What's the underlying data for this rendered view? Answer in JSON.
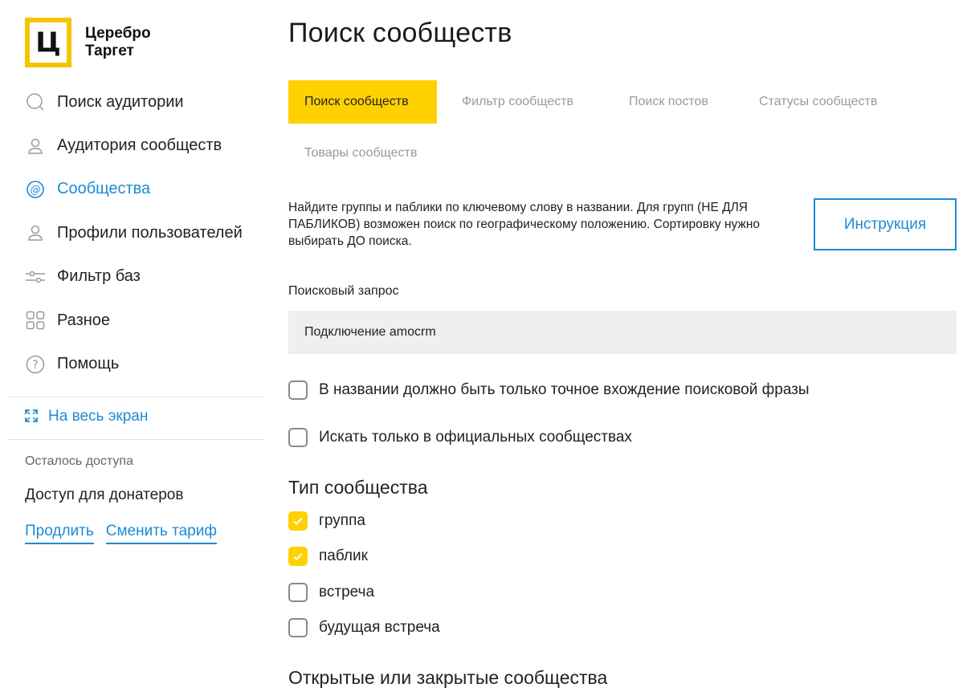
{
  "brand": {
    "logo_letter": "Ц",
    "name_line1": "Церебро",
    "name_line2": "Таргет",
    "accent": "#ffd100",
    "link": "#1b8bd6"
  },
  "sidebar": {
    "items": [
      {
        "label": "Поиск аудитории",
        "icon": "search-icon"
      },
      {
        "label": "Аудитория сообществ",
        "icon": "user-icon"
      },
      {
        "label": "Сообщества",
        "icon": "at-icon",
        "active": true
      },
      {
        "label": "Профили пользователей",
        "icon": "user-icon"
      },
      {
        "label": "Фильтр баз",
        "icon": "sliders-icon"
      },
      {
        "label": "Разное",
        "icon": "grid-icon"
      },
      {
        "label": "Помощь",
        "icon": "help-icon"
      }
    ],
    "fullscreen_label": "На весь экран",
    "access_label": "Осталось доступа",
    "access_value": "Доступ для донатеров",
    "extend_link": "Продлить",
    "change_plan_link": "Сменить тариф"
  },
  "main": {
    "title": "Поиск сообществ",
    "tabs": [
      {
        "label": "Поиск сообществ",
        "active": true
      },
      {
        "label": "Фильтр сообществ"
      },
      {
        "label": "Поиск постов"
      },
      {
        "label": "Статусы сообществ"
      },
      {
        "label": "Товары сообществ"
      }
    ],
    "description": "Найдите группы и паблики по ключевому слову в названии. Для групп (НЕ ДЛЯ ПАБЛИКОВ) возможен поиск по географическому положению. Сортировку нужно выбирать ДО поиска.",
    "instruction_button": "Инструкция",
    "query_label": "Поисковый запрос",
    "query_value": "Подключение amocrm",
    "options": [
      {
        "label": "В названии должно быть только точное вхождение поисковой фразы",
        "checked": false
      },
      {
        "label": "Искать только в официальных сообществах",
        "checked": false
      }
    ],
    "type_title": "Тип сообщества",
    "types": [
      {
        "label": "группа",
        "checked": true
      },
      {
        "label": "паблик",
        "checked": true
      },
      {
        "label": "встреча",
        "checked": false
      },
      {
        "label": "будущая встреча",
        "checked": false
      }
    ],
    "open_closed_title": "Открытые или закрытые сообщества"
  }
}
